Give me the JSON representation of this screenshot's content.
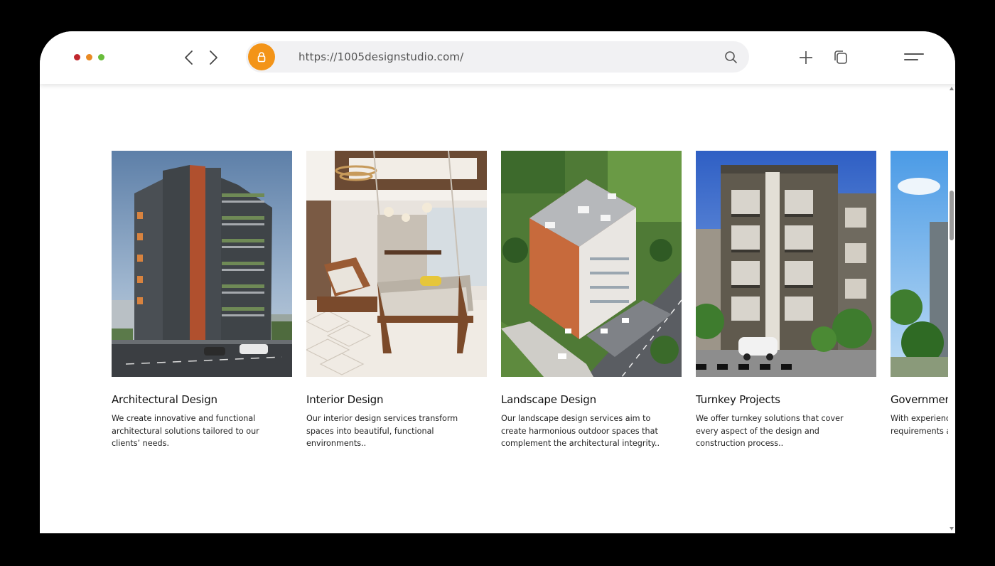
{
  "browser": {
    "url": "https://1005designstudio.com/",
    "icons": {
      "back": "chevron-left-icon",
      "forward": "chevron-right-icon",
      "lock": "lock-icon",
      "search": "search-icon",
      "new_tab": "plus-icon",
      "tabs": "tabs-icon",
      "menu": "menu-icon"
    },
    "colors": {
      "lock_badge": "#f39418",
      "dot_red": "#c0262d",
      "dot_orange": "#e98a24",
      "dot_green": "#69bd3b"
    }
  },
  "services": [
    {
      "title": "Architectural Design",
      "description": "We create innovative and functional architectural solutions tailored to our clients’ needs."
    },
    {
      "title": "Interior Design",
      "description": "Our interior design services transform spaces into beautiful, functional environments.."
    },
    {
      "title": "Landscape Design",
      "description": "Our landscape design services aim to create harmonious outdoor spaces that complement the architectural integrity.."
    },
    {
      "title": "Turnkey Projects",
      "description": "We offer turnkey solutions that cover every aspect of the design and construction process.."
    },
    {
      "title": "Government",
      "description": "With experience projects, we und requirements a"
    }
  ]
}
